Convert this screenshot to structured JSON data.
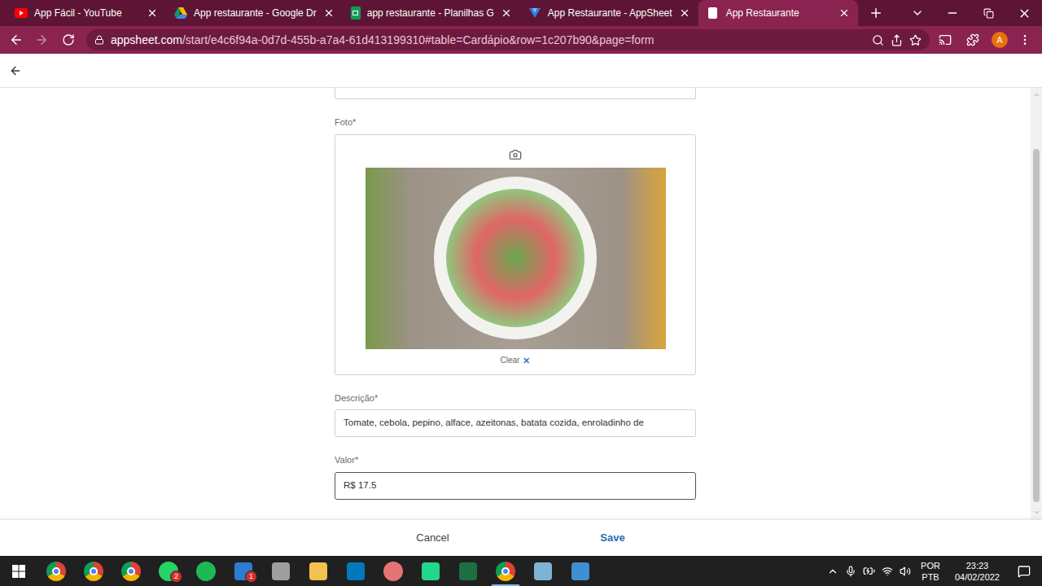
{
  "browser": {
    "tabs": [
      {
        "label": "App Fácil - YouTube",
        "selected": false,
        "kind": "youtube"
      },
      {
        "label": "App restaurante - Google Dr",
        "selected": false,
        "kind": "drive"
      },
      {
        "label": "app restaurante - Planilhas G",
        "selected": false,
        "kind": "sheets"
      },
      {
        "label": "App Restaurante - AppSheet",
        "selected": false,
        "kind": "appsheet"
      },
      {
        "label": "App Restaurante",
        "selected": true,
        "kind": "page"
      }
    ],
    "address": {
      "host": "appsheet.com",
      "path": "/start/e4c6f94a-0d7d-455b-a7a4-61d413199310#table=Cardápio&row=1c207b90&page=form"
    },
    "profile": "A"
  },
  "form": {
    "photo": {
      "label": "Foto",
      "mark": "*",
      "clear": "Clear",
      "clear_icon": "✕"
    },
    "fields": [
      {
        "label": "Descrição",
        "mark": "*",
        "value": "Tomate, cebola, pepino, alface, azeitonas, batata cozida, enroladinho de",
        "focused": false
      },
      {
        "label": "Valor",
        "mark": "*",
        "value": "R$ 17.5",
        "focused": true
      }
    ]
  },
  "footer": {
    "buttons": [
      {
        "label": "Cancel",
        "kind": "secondary"
      },
      {
        "label": "Save",
        "kind": "primary"
      }
    ]
  },
  "taskbar": {
    "apps": [
      {
        "kind": "chrome",
        "color": "#4285f4",
        "badge": "",
        "active": false
      },
      {
        "kind": "chrome",
        "color": "#4285f4",
        "badge": "",
        "active": false
      },
      {
        "kind": "chrome",
        "color": "#4285f4",
        "badge": "",
        "active": false
      },
      {
        "kind": "round",
        "color": "#25d366",
        "badge": "2",
        "active": false
      },
      {
        "kind": "round",
        "color": "#1db954",
        "badge": "",
        "active": false
      },
      {
        "kind": "square",
        "color": "#2b7cd3",
        "badge": "1",
        "active": false
      },
      {
        "kind": "square",
        "color": "#9e9e9e",
        "badge": "",
        "active": false
      },
      {
        "kind": "square",
        "color": "#f2c14e",
        "badge": "",
        "active": false
      },
      {
        "kind": "square",
        "color": "#0079bf",
        "badge": "",
        "active": false
      },
      {
        "kind": "round",
        "color": "#e57373",
        "badge": "",
        "active": false
      },
      {
        "kind": "square",
        "color": "#21d789",
        "badge": "",
        "active": false
      },
      {
        "kind": "square",
        "color": "#1d6f42",
        "badge": "",
        "active": false
      },
      {
        "kind": "chrome",
        "color": "#4285f4",
        "badge": "",
        "active": true
      },
      {
        "kind": "square",
        "color": "#7fb3d5",
        "badge": "",
        "active": false
      },
      {
        "kind": "square",
        "color": "#3f8fd2",
        "badge": "",
        "active": false
      }
    ],
    "tray": {
      "language": [
        "POR",
        "PTB"
      ],
      "time": "23:23",
      "date": "04/02/2022"
    }
  }
}
